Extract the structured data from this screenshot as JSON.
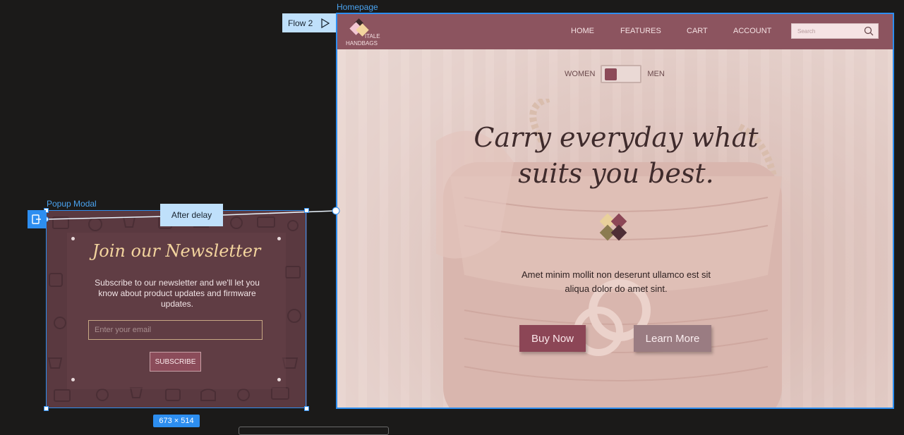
{
  "canvas": {
    "homepage_label": "Homepage",
    "popup_label": "Popup Modal",
    "flow_tag": "Flow 2",
    "interaction_trigger": "After delay",
    "selection_size": "673 × 514"
  },
  "homepage": {
    "logo": {
      "line1": "ITALE",
      "line2": "HANDBAGS"
    },
    "nav": [
      "HOME",
      "FEATURES",
      "CART",
      "ACCOUNT"
    ],
    "search": {
      "placeholder": "Search"
    },
    "toggle": {
      "left": "WOMEN",
      "right": "MEN"
    },
    "headline": "Carry everyday what suits you best.",
    "body": "Amet minim mollit non deserunt ullamco est sit aliqua dolor do amet sint.",
    "buttons": {
      "primary": "Buy Now",
      "secondary": "Learn More"
    }
  },
  "popup": {
    "title": "Join our Newsletter",
    "body": "Subscribe to our newsletter and we'll let you know about product updates and firmware updates.",
    "email_placeholder": "Enter your email",
    "button": "SUBSCRIBE"
  },
  "colors": {
    "nav": "#8c545f",
    "accent": "#8c4656",
    "selection": "#2d8ef0",
    "popup_bg": "#5a3940",
    "popup_title": "#f3d49e"
  },
  "icons": [
    "play-icon",
    "search-icon",
    "logo-diamond-icon",
    "emblem-diamond-icon",
    "trigger-icon"
  ]
}
